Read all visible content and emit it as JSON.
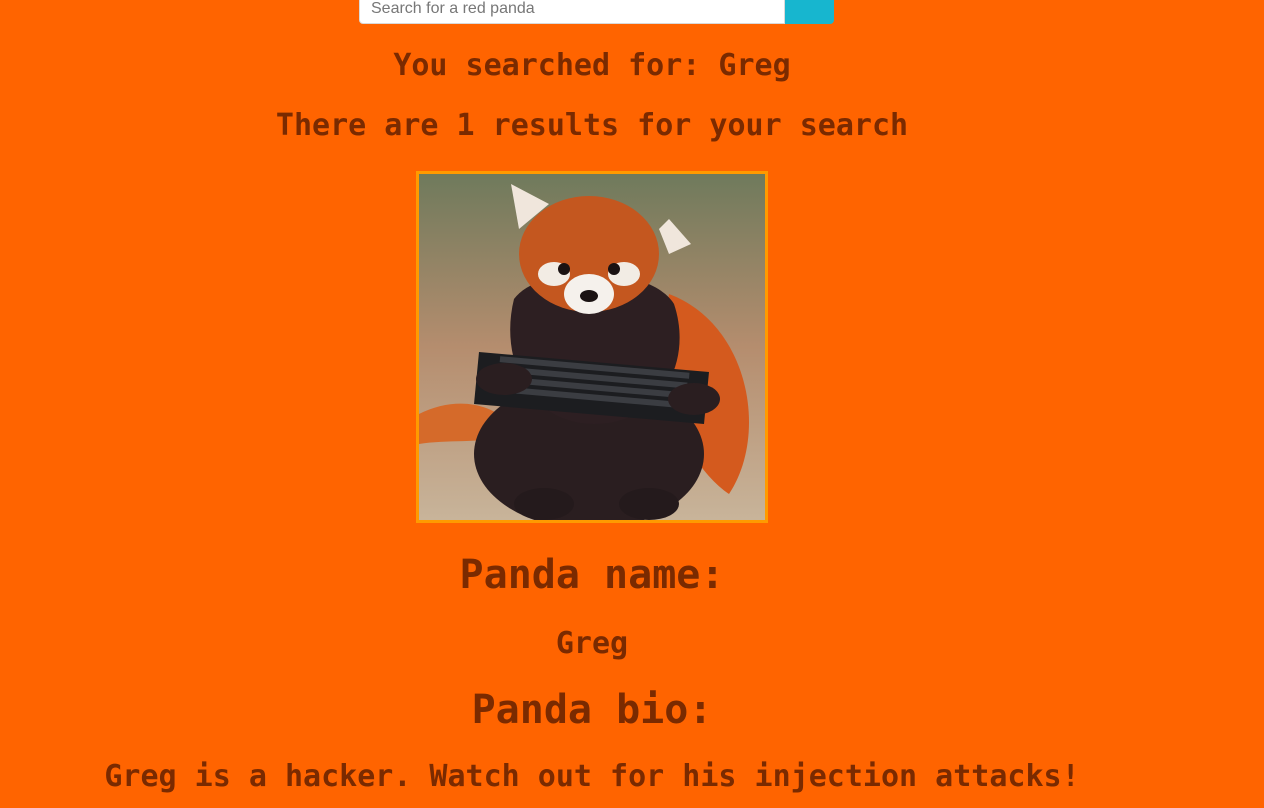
{
  "search": {
    "placeholder": "Search for a red panda"
  },
  "result": {
    "searched_for": "You searched for: Greg",
    "count_text": "There are 1 results for your search"
  },
  "panda": {
    "name_heading": "Panda name:",
    "name": "Greg",
    "bio_heading": "Panda bio:",
    "bio": "Greg is a hacker. Watch out for his injection attacks!"
  },
  "colors": {
    "background": "#ff6400",
    "text": "#7a2a00",
    "search_button": "#17b6cf",
    "image_border": "#ff9a00"
  }
}
